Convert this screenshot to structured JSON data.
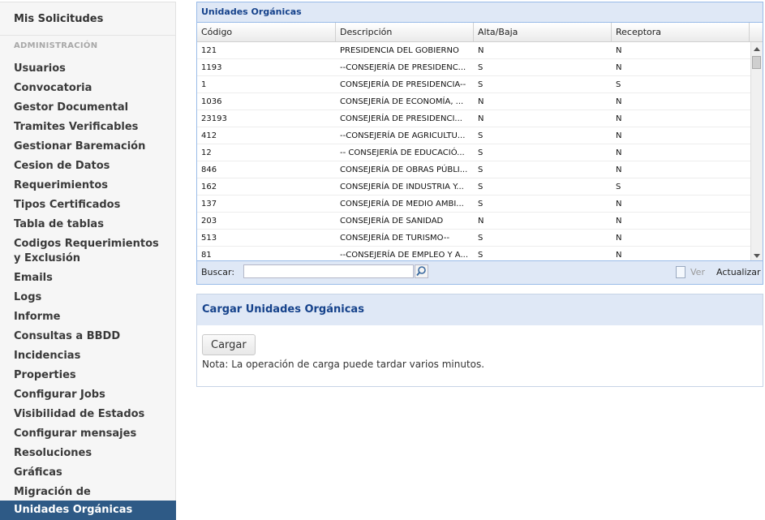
{
  "sidebar": {
    "top_item": "Mis Solicitudes",
    "section": "ADMINISTRACIÓN",
    "items": [
      {
        "label": "Usuarios"
      },
      {
        "label": "Convocatoria"
      },
      {
        "label": "Gestor Documental"
      },
      {
        "label": "Tramites Verificables"
      },
      {
        "label": "Gestionar Baremación"
      },
      {
        "label": "Cesion de Datos"
      },
      {
        "label": "Requerimientos"
      },
      {
        "label": "Tipos Certificados"
      },
      {
        "label": "Tabla de tablas"
      },
      {
        "label": "Codigos Requerimientos y Exclusión"
      },
      {
        "label": "Emails"
      },
      {
        "label": "Logs"
      },
      {
        "label": "Informe"
      },
      {
        "label": "Consultas a BBDD"
      },
      {
        "label": "Incidencias"
      },
      {
        "label": "Properties"
      },
      {
        "label": "Configurar Jobs"
      },
      {
        "label": "Visibilidad de Estados"
      },
      {
        "label": "Configurar mensajes"
      },
      {
        "label": "Resoluciones"
      },
      {
        "label": "Gráficas"
      },
      {
        "label": "Migración de Aportaciones"
      },
      {
        "label": "Unidades Orgánicas",
        "active": true
      }
    ]
  },
  "grid": {
    "title": "Unidades Orgánicas",
    "columns": [
      "Código",
      "Descripción",
      "Alta/Baja",
      "Receptora"
    ],
    "rows": [
      [
        "121",
        "PRESIDENCIA DEL GOBIERNO",
        "N",
        "N"
      ],
      [
        "1193",
        "--CONSEJERÍA DE PRESIDENC...",
        "S",
        "N"
      ],
      [
        "1",
        "CONSEJERÍA DE PRESIDENCIA--",
        "S",
        "S"
      ],
      [
        "1036",
        "CONSEJERÍA DE ECONOMÍA, ...",
        "N",
        "N"
      ],
      [
        "23193",
        "CONSEJERÍA DE PRESIDENCI...",
        "N",
        "N"
      ],
      [
        "412",
        "--CONSEJERÍA DE AGRICULTU...",
        "S",
        "N"
      ],
      [
        "12",
        "-- CONSEJERÍA DE EDUCACIÓ...",
        "S",
        "N"
      ],
      [
        "846",
        "CONSEJERÍA DE OBRAS PÚBLI...",
        "S",
        "N"
      ],
      [
        "162",
        "CONSEJERÍA DE INDUSTRIA Y...",
        "S",
        "S"
      ],
      [
        "137",
        "CONSEJERÍA DE MEDIO AMBI...",
        "S",
        "N"
      ],
      [
        "203",
        "CONSEJERÍA DE SANIDAD",
        "N",
        "N"
      ],
      [
        "513",
        "CONSEJERÍA DE TURISMO--",
        "S",
        "N"
      ],
      [
        "81",
        "--CONSEJERÍA DE EMPLEO Y A...",
        "S",
        "N"
      ]
    ],
    "footer": {
      "search_label": "Buscar:",
      "search_value": "",
      "view_label": "Ver",
      "refresh_label": "Actualizar"
    }
  },
  "cargar": {
    "title": "Cargar Unidades Orgánicas",
    "button_label": "Cargar",
    "note": "Nota: La operación de carga puede tardar varios minutos."
  },
  "colors": {
    "accent": "#2e5a86",
    "panel_header": "#dfe8f6",
    "panel_title_text": "#15428b",
    "panel_border": "#99bbe8"
  }
}
